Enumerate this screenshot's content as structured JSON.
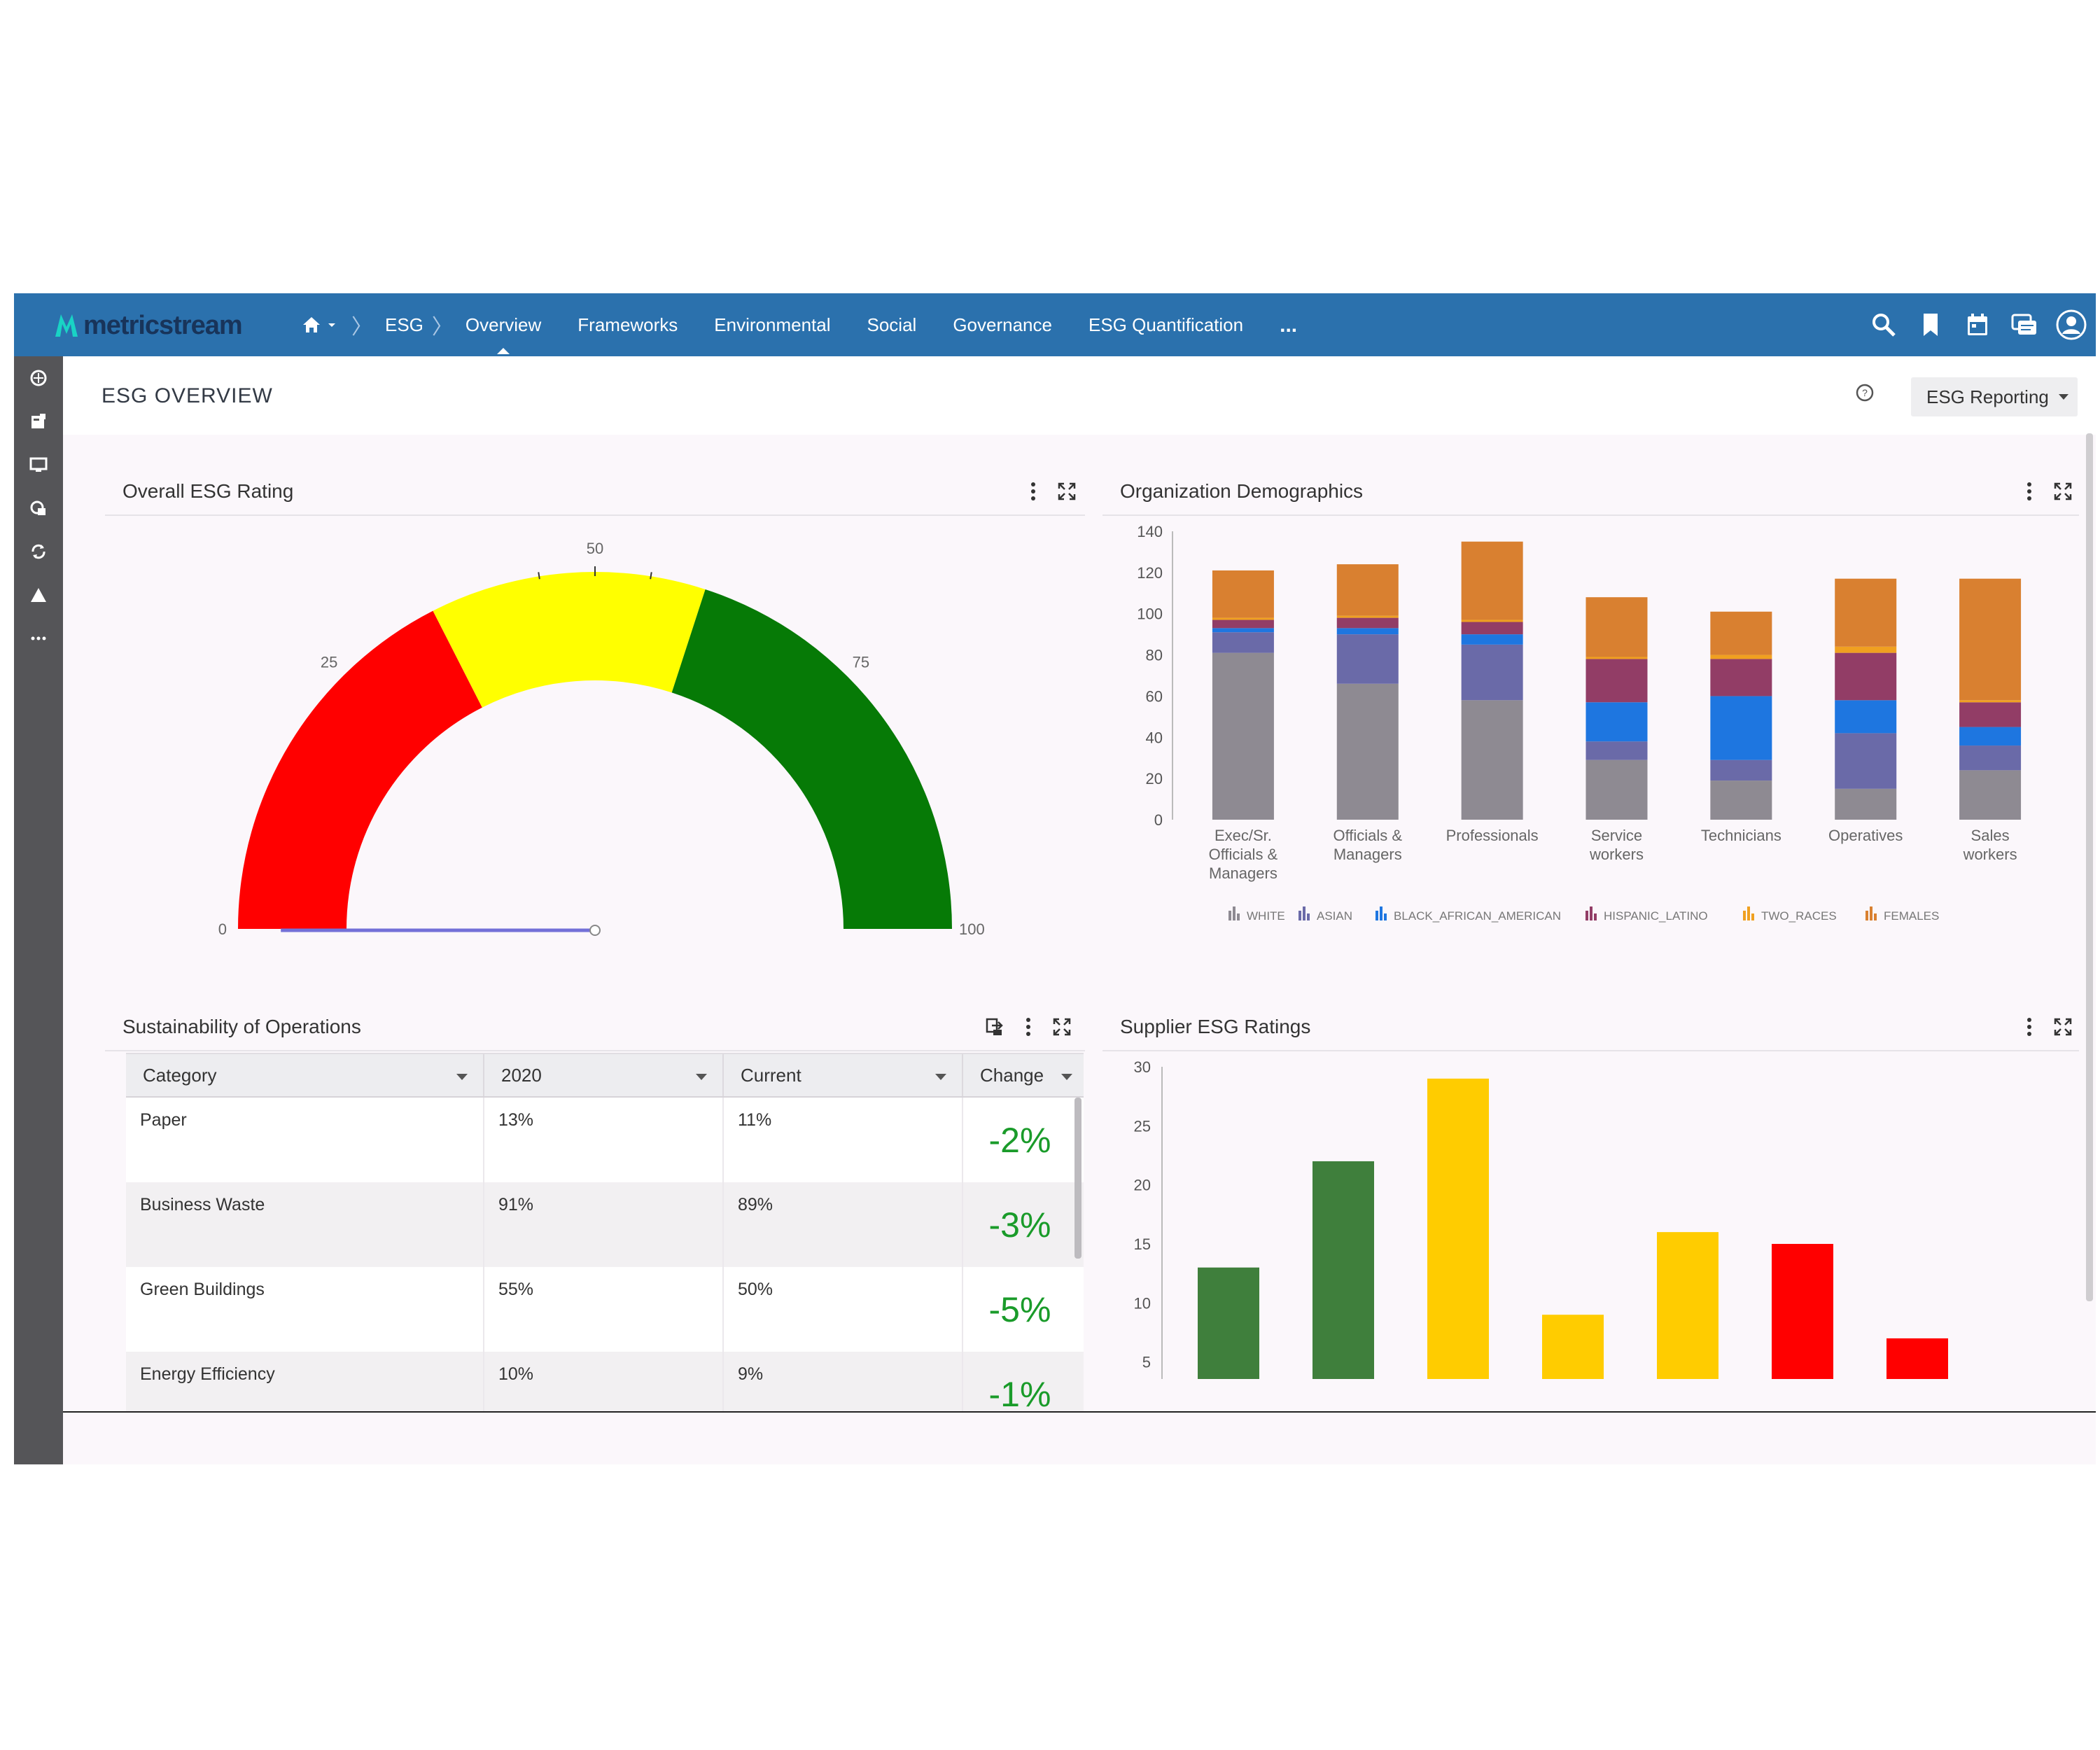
{
  "app": {
    "brand": "metricstream"
  },
  "nav": {
    "crumbs": [
      "ESG"
    ],
    "items": [
      {
        "label": "Overview",
        "active": true
      },
      {
        "label": "Frameworks"
      },
      {
        "label": "Environmental"
      },
      {
        "label": "Social"
      },
      {
        "label": "Governance"
      },
      {
        "label": "ESG Quantification"
      }
    ],
    "more": "..."
  },
  "topbar_icons": [
    "search-icon",
    "bookmark-icon",
    "calendar-icon",
    "messages-icon",
    "user-profile-icon"
  ],
  "rail_icons": [
    "nav-icon-esg",
    "nav-icon-report",
    "nav-icon-monitor",
    "nav-icon-catalog",
    "nav-icon-refresh",
    "nav-icon-warning",
    "nav-icon-more"
  ],
  "page": {
    "title": "ESG OVERVIEW",
    "report_button": "ESG Reporting"
  },
  "widgets": {
    "rating": {
      "title": "Overall ESG Rating"
    },
    "demographics": {
      "title": "Organization Demographics"
    },
    "operations": {
      "title": "Sustainability of Operations"
    },
    "suppliers": {
      "title": "Supplier ESG Ratings"
    }
  },
  "colors": {
    "topbar": "#2b71ad",
    "gauge_red": "#ff0000",
    "gauge_yellow": "#ffff00",
    "gauge_green": "#067a06",
    "change_green": "#1a9b2a"
  },
  "operations_table": {
    "columns": [
      "Category",
      "2020",
      "Current",
      "Change"
    ],
    "rows": [
      {
        "category": "Paper",
        "y2020": "13%",
        "current": "11%",
        "change": "-2%"
      },
      {
        "category": "Business Waste",
        "y2020": "91%",
        "current": "89%",
        "change": "-3%"
      },
      {
        "category": "Green Buildings",
        "y2020": "55%",
        "current": "50%",
        "change": "-5%"
      },
      {
        "category": "Energy Efficiency",
        "y2020": "10%",
        "current": "9%",
        "change": "-1%"
      }
    ]
  },
  "chart_data": [
    {
      "id": "overall-esg-rating",
      "type": "gauge",
      "range": [
        0,
        100
      ],
      "tick_labels": [
        "0",
        "25",
        "50",
        "75",
        "100"
      ],
      "bands": [
        {
          "from": 0,
          "to": 35,
          "color": "#ff0000"
        },
        {
          "from": 35,
          "to": 60,
          "color": "#ffff00"
        },
        {
          "from": 60,
          "to": 100,
          "color": "#067a06"
        }
      ],
      "value": 0
    },
    {
      "id": "organization-demographics",
      "type": "bar",
      "stacked": true,
      "categories": [
        "Exec/Sr. Officials & Managers",
        "Officials & Managers",
        "Professionals",
        "Service workers",
        "Technicians",
        "Operatives",
        "Sales workers"
      ],
      "series": [
        {
          "name": "WHITE",
          "color": "#8e8a92",
          "values": [
            81,
            66,
            58,
            29,
            19,
            15,
            24
          ]
        },
        {
          "name": "ASIAN",
          "color": "#6a6aa8",
          "values": [
            10,
            24,
            27,
            9,
            10,
            27,
            12
          ]
        },
        {
          "name": "BLACK_AFRICAN_AMERICAN",
          "color": "#1e76e0",
          "values": [
            2,
            3,
            5,
            19,
            31,
            16,
            9
          ]
        },
        {
          "name": "HISPANIC_LATINO",
          "color": "#923d66",
          "values": [
            4,
            5,
            6,
            21,
            18,
            23,
            12
          ]
        },
        {
          "name": "TWO_RACES",
          "color": "#f0a020",
          "values": [
            1,
            1,
            1,
            1,
            2,
            3,
            1
          ]
        },
        {
          "name": "FEMALES",
          "color": "#d98030",
          "values": [
            23,
            25,
            38,
            29,
            21,
            33,
            59
          ]
        }
      ],
      "ylim": [
        0,
        140
      ],
      "yticks": [
        0,
        20,
        40,
        60,
        80,
        100,
        120,
        140
      ],
      "legend": "bottom"
    },
    {
      "id": "supplier-esg-ratings",
      "type": "bar",
      "values": [
        13,
        22,
        29,
        9,
        16,
        15,
        7
      ],
      "colors": [
        "#3f7f3c",
        "#3f7f3c",
        "#ffcc00",
        "#ffcc00",
        "#ffcc00",
        "#ff0000",
        "#ff0000"
      ],
      "ylim": [
        0,
        30
      ],
      "yticks": [
        5,
        10,
        15,
        20,
        25,
        30
      ],
      "visible_range": [
        2,
        30
      ]
    }
  ]
}
